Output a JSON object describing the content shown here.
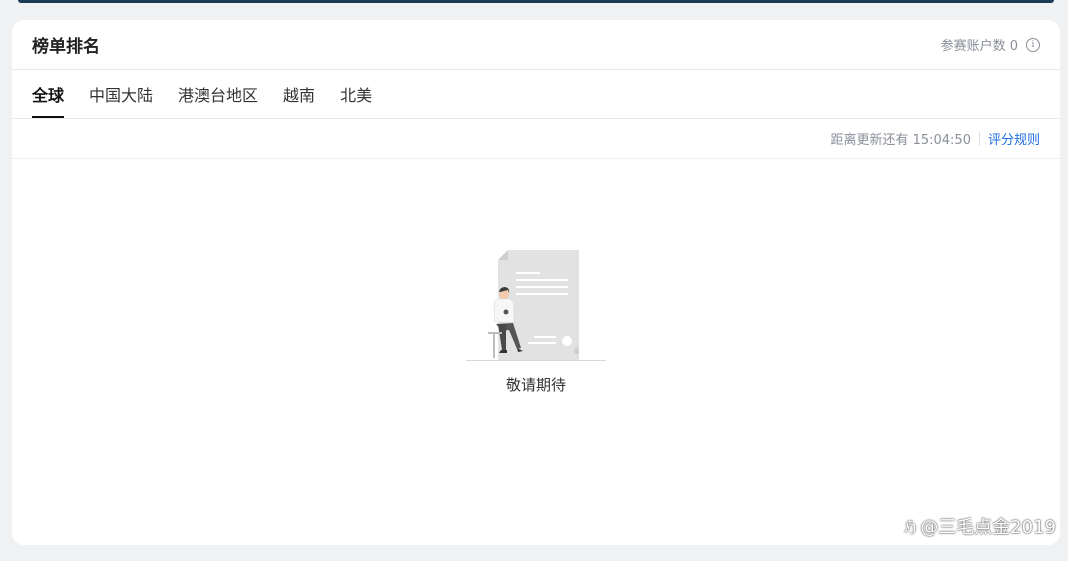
{
  "card": {
    "title": "榜单排名",
    "participants_label": "参赛账户数 0"
  },
  "tabs": [
    {
      "label": "全球",
      "active": true
    },
    {
      "label": "中国大陆",
      "active": false
    },
    {
      "label": "港澳台地区",
      "active": false
    },
    {
      "label": "越南",
      "active": false
    },
    {
      "label": "北美",
      "active": false
    }
  ],
  "subbar": {
    "countdown": "距离更新还有 15:04:50",
    "rules_link": "评分规则"
  },
  "empty_state": {
    "text": "敬请期待"
  },
  "watermark": {
    "logo": "ℌ",
    "text": "@三毛点金2019"
  },
  "colors": {
    "accent_link": "#1f6fe5",
    "muted_text": "#8a8f99",
    "page_bg": "#f0f1f3"
  }
}
